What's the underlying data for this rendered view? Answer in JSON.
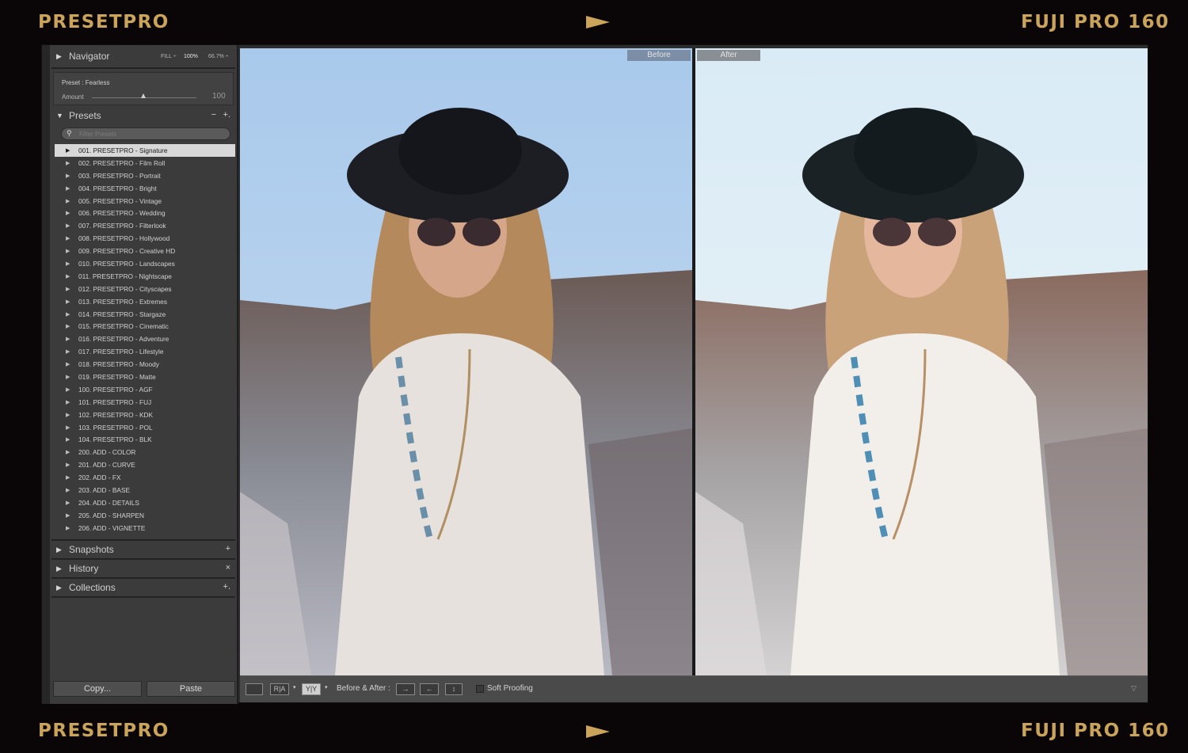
{
  "brand": {
    "top_left": "PRESETPRO",
    "top_right": "FUJI PRO 160",
    "bottom_left": "PRESETPRO",
    "bottom_right": "FUJI PRO 160"
  },
  "navigator": {
    "title": "Navigator",
    "fill": "FILL ÷",
    "zoom1": "100%",
    "zoom2": "66.7% ÷"
  },
  "preset_info": {
    "label": "Preset : Fearless",
    "amount_label": "Amount",
    "amount_value": "100"
  },
  "presets": {
    "title": "Presets",
    "minus": "−",
    "plus": "+.",
    "filter_placeholder": "Filter Presets",
    "items": [
      "001. PRESETPRO - Signature",
      "002. PRESETPRO - Film Roll",
      "003. PRESETPRO - Portrait",
      "004. PRESETPRO - Bright",
      "005. PRESETPRO - Vintage",
      "006. PRESETPRO - Wedding",
      "007. PRESETPRO - Filterlook",
      "008. PRESETPRO - Hollywood",
      "009. PRESETPRO - Creative HD",
      "010. PRESETPRO - Landscapes",
      "011. PRESETPRO - Nightscape",
      "012. PRESETPRO - Cityscapes",
      "013. PRESETPRO - Extremes",
      "014. PRESETPRO - Stargaze",
      "015. PRESETPRO - Cinematic",
      "016. PRESETPRO - Adventure",
      "017. PRESETPRO - Lifestyle",
      "018. PRESETPRO - Moody",
      "019. PRESETPRO - Matte",
      "100. PRESETPRO - AGF",
      "101. PRESETPRO - FUJ",
      "102. PRESETPRO - KDK",
      "103. PRESETPRO - POL",
      "104. PRESETPRO - BLK",
      "200. ADD - COLOR",
      "201. ADD - CURVE",
      "202. ADD - FX",
      "203. ADD - BASE",
      "204. ADD - DETAILS",
      "205. ADD - SHARPEN",
      "206. ADD - VIGNETTE"
    ],
    "selected_index": 0
  },
  "snapshots": {
    "title": "Snapshots",
    "action": "+"
  },
  "history": {
    "title": "History",
    "action": "×"
  },
  "collections": {
    "title": "Collections",
    "action": "+."
  },
  "buttons": {
    "copy": "Copy...",
    "paste": "Paste"
  },
  "view": {
    "before": "Before",
    "after": "After"
  },
  "toolbar": {
    "ba_label": "Before & After :",
    "soft_proofing": "Soft Proofing",
    "swap1": "→",
    "swap2": "←",
    "swap3": "↕"
  },
  "icons": {
    "collapsed": "triangle-right-icon",
    "expanded": "triangle-down-icon",
    "search": "search-icon"
  },
  "colors": {
    "brand_gold": "#c9a45a",
    "panel": "#3b3b3b",
    "selected_row": "#d8d8d8"
  }
}
